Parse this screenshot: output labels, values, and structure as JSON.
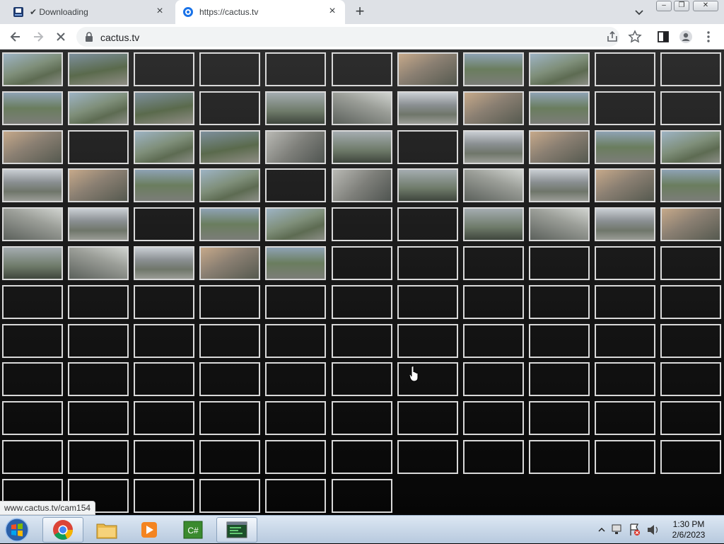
{
  "browser": {
    "tabs": [
      {
        "title": "✔ Downloading",
        "active": false
      },
      {
        "title": "https://cactus.tv",
        "active": true
      }
    ],
    "url": "cactus.tv",
    "status_url": "www.cactus.tv/cam154"
  },
  "grid": {
    "rows": 12,
    "cols": 11,
    "last_row_cells": 6,
    "thumbnails": [
      [
        1,
        1,
        0,
        0,
        0,
        0,
        1,
        1,
        1,
        0,
        0
      ],
      [
        1,
        1,
        1,
        0,
        1,
        1,
        1,
        1,
        1,
        0,
        0
      ],
      [
        1,
        0,
        1,
        1,
        1,
        1,
        0,
        1,
        1,
        1,
        1
      ],
      [
        1,
        1,
        1,
        1,
        0,
        1,
        1,
        1,
        1,
        1,
        1
      ],
      [
        1,
        1,
        0,
        1,
        1,
        0,
        0,
        1,
        1,
        1,
        1
      ],
      [
        1,
        1,
        1,
        1,
        1,
        0,
        0,
        0,
        0,
        0,
        0
      ]
    ]
  },
  "taskbar": {
    "items": [
      "chrome",
      "file-explorer",
      "media-player",
      "csharp-editor",
      "terminal-app"
    ],
    "active_item": "chrome",
    "clock_time": "1:30 PM",
    "clock_date": "2/6/2023"
  }
}
